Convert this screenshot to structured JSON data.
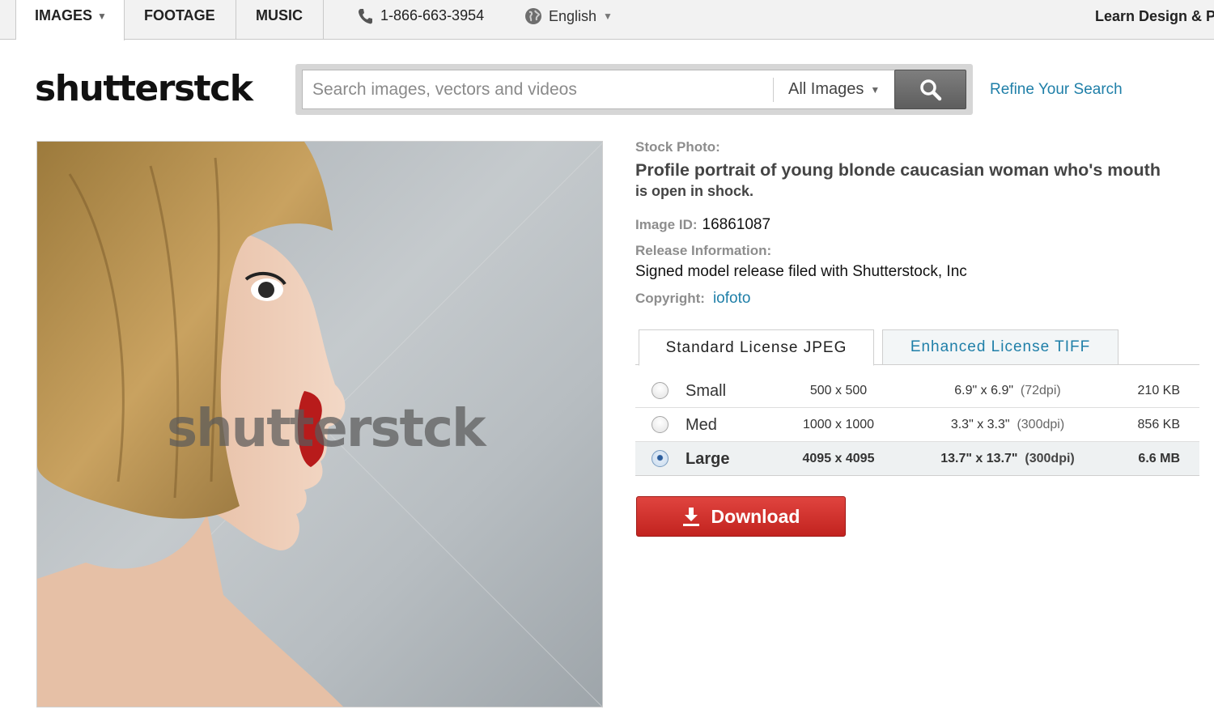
{
  "topnav": {
    "tabs": [
      {
        "label": "IMAGES",
        "active": true,
        "has_dropdown": true
      },
      {
        "label": "FOOTAGE",
        "active": false,
        "has_dropdown": false
      },
      {
        "label": "MUSIC",
        "active": false,
        "has_dropdown": false
      }
    ],
    "phone": "1-866-663-3954",
    "language": "English",
    "learn": "Learn Design & P"
  },
  "header": {
    "logo": "shutterstck",
    "search": {
      "placeholder": "Search images, vectors and videos",
      "value": "",
      "filter": "All Images"
    },
    "refine_link": "Refine Your Search"
  },
  "photo": {
    "watermark": "shutterstck"
  },
  "details": {
    "stock_label": "Stock Photo:",
    "title_line1": "Profile portrait of young blonde caucasian woman who's mouth",
    "title_line2": "is open in shock.",
    "image_id_label": "Image ID:",
    "image_id": "16861087",
    "release_label": "Release Information:",
    "release_value": "Signed model release filed with Shutterstock, Inc",
    "copyright_label": "Copyright:",
    "copyright_value": "iofoto"
  },
  "license": {
    "tabs": [
      "Standard License JPEG",
      "Enhanced License TIFF"
    ],
    "active_tab": 0,
    "sizes": [
      {
        "name": "Small",
        "pixels": "500 x 500",
        "inches": "6.9\" x 6.9\"",
        "dpi": "(72dpi)",
        "filesize": "210 KB",
        "selected": false
      },
      {
        "name": "Med",
        "pixels": "1000 x 1000",
        "inches": "3.3\" x 3.3\"",
        "dpi": "(300dpi)",
        "filesize": "856 KB",
        "selected": false
      },
      {
        "name": "Large",
        "pixels": "4095 x 4095",
        "inches": "13.7\" x 13.7\"",
        "dpi": "(300dpi)",
        "filesize": "6.6 MB",
        "selected": true
      }
    ]
  },
  "download_label": "Download",
  "colors": {
    "link": "#1f7fa8",
    "download": "#d0302b",
    "search_button": "#6b6b6b"
  }
}
